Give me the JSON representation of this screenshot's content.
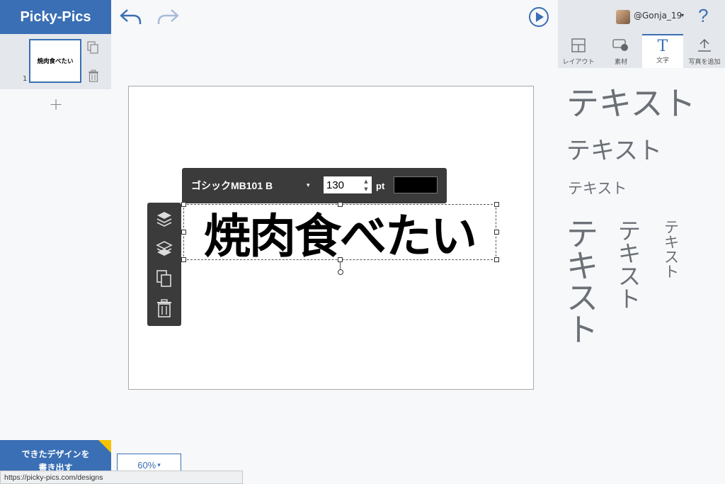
{
  "app": {
    "title": "Picky-Pics"
  },
  "pages": {
    "thumbnail_text": "焼肉食べたい",
    "page_number": "1",
    "add_label": "+"
  },
  "user": {
    "name": "@Gonja_19",
    "caret": "▾",
    "help": "?"
  },
  "tabs": [
    {
      "label": "レイアウト"
    },
    {
      "label": "素材"
    },
    {
      "label": "文字"
    },
    {
      "label": "写真を追加"
    }
  ],
  "text_samples": {
    "horizontal": [
      "テキスト",
      "テキスト",
      "テキスト"
    ],
    "vertical": [
      [
        "テ",
        "キ",
        "ス",
        "ト"
      ],
      [
        "テ",
        "キ",
        "ス",
        "ト"
      ],
      [
        "テ",
        "キ",
        "ス",
        "ト"
      ]
    ]
  },
  "text_toolbar": {
    "font_name": "ゴシックMB101 B",
    "caret": "▾",
    "font_size": "130",
    "unit": "pt",
    "color": "#000000"
  },
  "canvas": {
    "selected_text": "焼肉食べたい"
  },
  "bottom": {
    "export_label_1": "できたデザインを",
    "export_label_2": "書き出す",
    "zoom": "60%",
    "zoom_caret": "▾"
  },
  "statusbar": {
    "url": "https://picky-pics.com/designs"
  },
  "colors": {
    "brand": "#3a6fb5",
    "accent": "#f5c400",
    "toolbar": "#3b3b3b"
  }
}
